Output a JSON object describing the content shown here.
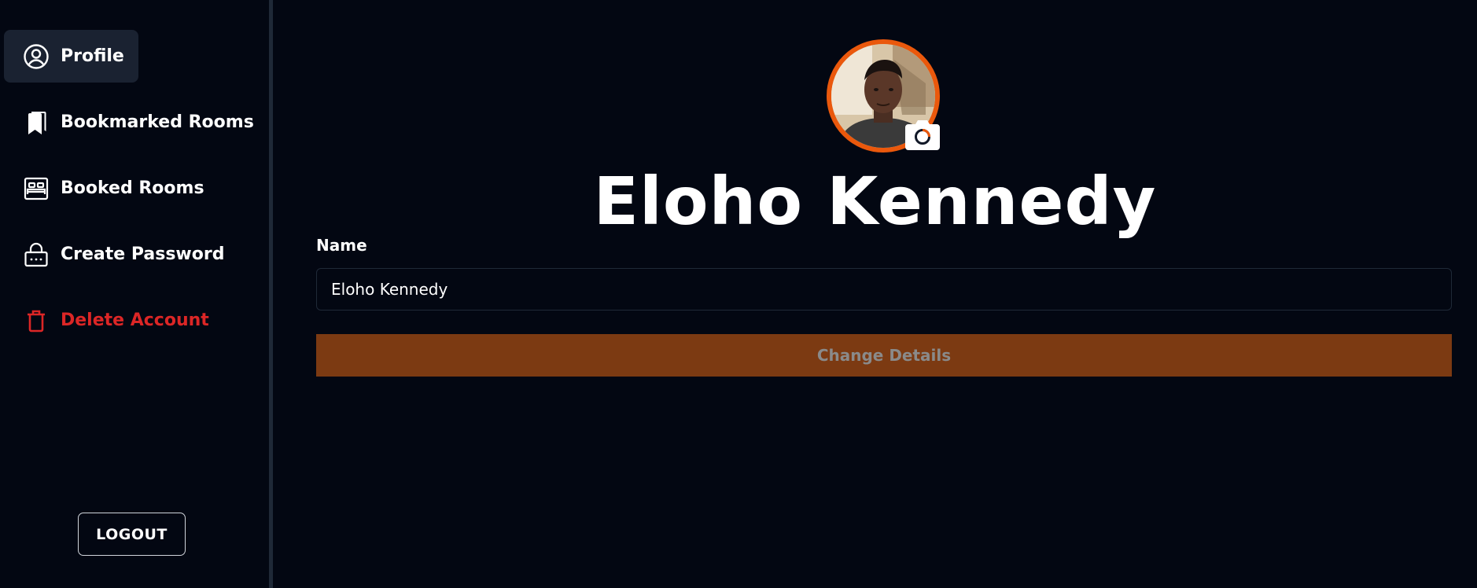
{
  "sidebar": {
    "items": [
      {
        "label": "Profile",
        "icon": "user-circle-icon",
        "active": true
      },
      {
        "label": "Bookmarked Rooms",
        "icon": "bookmark-icon"
      },
      {
        "label": "Booked Rooms",
        "icon": "bed-icon"
      },
      {
        "label": "Create Password",
        "icon": "lock-icon"
      },
      {
        "label": "Delete Account",
        "icon": "trash-icon",
        "color": "#dc2626"
      }
    ],
    "logout_label": "LOGOUT"
  },
  "profile": {
    "name": "Eloho Kennedy",
    "accent_color": "#ea580c"
  },
  "form": {
    "name_label": "Name",
    "name_value": "Eloho Kennedy",
    "submit_label": "Change Details",
    "submit_color": "#7c3a12"
  }
}
